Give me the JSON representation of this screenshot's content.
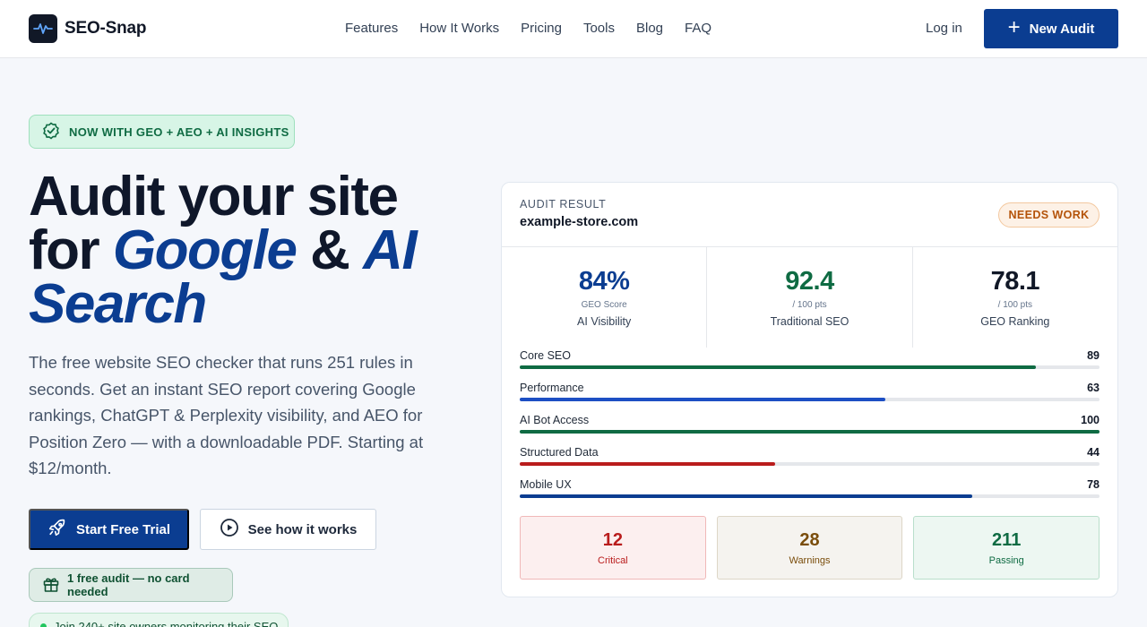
{
  "nav": {
    "brand": "SEO-Snap",
    "links": [
      "Features",
      "How It Works",
      "Pricing",
      "Tools",
      "Blog",
      "FAQ"
    ],
    "login": "Log in",
    "cta": "New Audit"
  },
  "hero": {
    "badge": "NOW WITH GEO + AEO + AI INSIGHTS",
    "headline": {
      "line1": "Audit your site",
      "for": "for ",
      "google": "Google",
      "amp": " & ",
      "ai": "AI",
      "search": "Search"
    },
    "lead": "The free website SEO checker that runs 251 rules in seconds. Get an instant SEO report covering Google rankings, ChatGPT & Perplexity visibility, and AEO for Position Zero — with a downloadable PDF. Starting at $12/month.",
    "primary_cta": "Start Free Trial",
    "secondary_cta": "See how it works",
    "free_note": "1 free audit — no card needed",
    "social_proof": "Join 240+ site owners monitoring their SEO"
  },
  "audit": {
    "label": "AUDIT RESULT",
    "site": "example-store.com",
    "status": "NEEDS WORK",
    "scores": [
      {
        "value": "84%",
        "sub": "GEO Score",
        "name": "AI Visibility",
        "color": "#0b3d91"
      },
      {
        "value": "92.4",
        "sub": "/ 100 pts",
        "name": "Traditional SEO",
        "color": "#0f6b43"
      },
      {
        "value": "78.1",
        "sub": "/ 100 pts",
        "name": "GEO Ranking",
        "color": "#111827"
      }
    ],
    "bars": [
      {
        "label": "Core SEO",
        "value": 89,
        "color": "#0f6b43"
      },
      {
        "label": "Performance",
        "value": 63,
        "color": "#1d4fc4"
      },
      {
        "label": "AI Bot Access",
        "value": 100,
        "color": "#0f6b43"
      },
      {
        "label": "Structured Data",
        "value": 44,
        "color": "#b91c1c"
      },
      {
        "label": "Mobile UX",
        "value": 78,
        "color": "#0b3d91"
      }
    ],
    "tiles": [
      {
        "value": "12",
        "label": "Critical"
      },
      {
        "value": "28",
        "label": "Warnings"
      },
      {
        "value": "211",
        "label": "Passing"
      }
    ]
  }
}
